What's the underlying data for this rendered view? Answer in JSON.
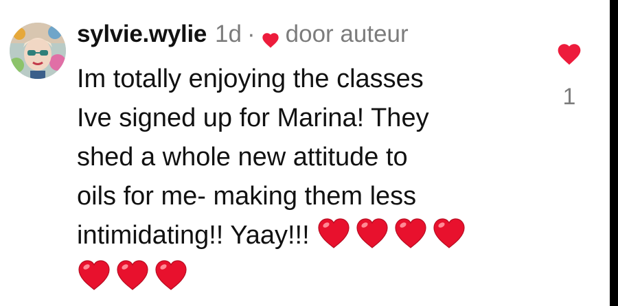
{
  "comment": {
    "username": "sylvie.wylie",
    "time": "1d",
    "separator": "·",
    "author_label": "door auteur",
    "text_lines": [
      "Im totally enjoying the classes",
      "Ive signed up for Marina! They",
      "shed a whole new attitude to",
      "oils for me- making them less",
      "intimidating!! Yaay!!!"
    ],
    "inline_emoji": [
      "❤️",
      "❤️",
      "❤️",
      "❤️"
    ],
    "trailing_emoji": [
      "❤️",
      "❤️",
      "❤️"
    ]
  },
  "like": {
    "icon": "heart-filled-icon",
    "count": "1"
  },
  "colors": {
    "heart_red": "#ed1c3c",
    "muted_text": "#7c7c7c",
    "text": "#111111"
  }
}
